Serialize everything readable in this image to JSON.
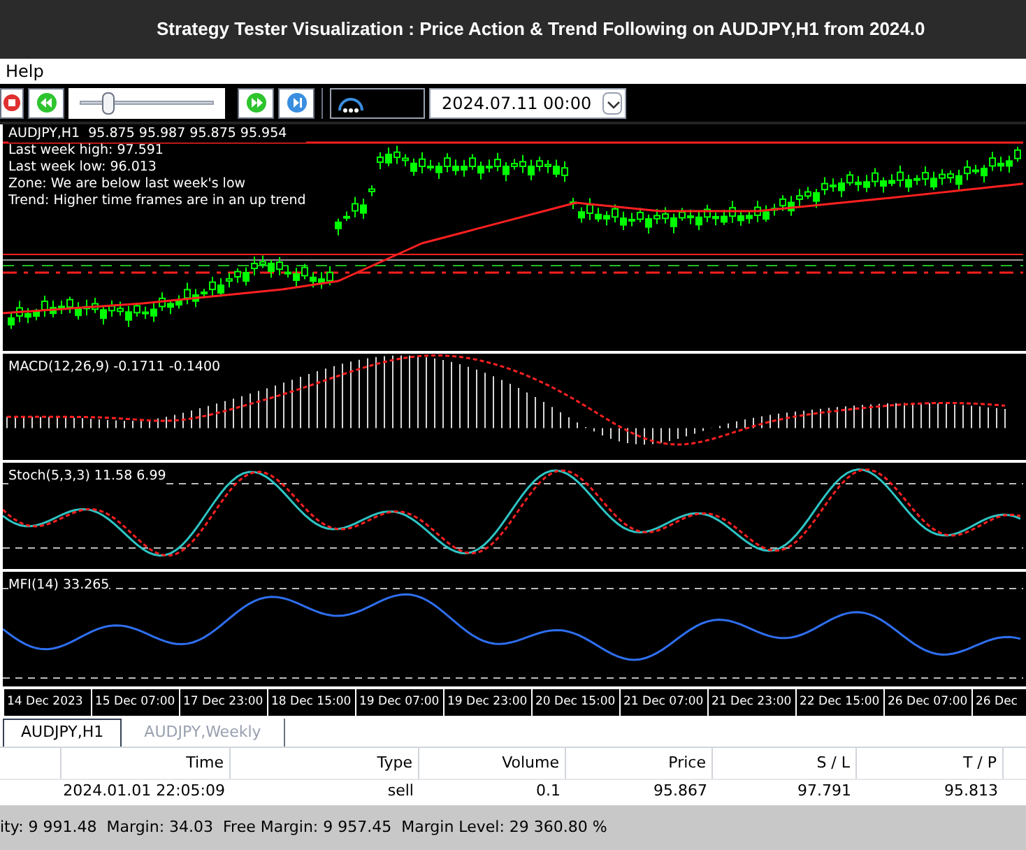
{
  "window": {
    "title": "Strategy Tester Visualization : Price Action & Trend Following on AUDJPY,H1 from 2024.0"
  },
  "menu": [
    "Help"
  ],
  "toolbar": {
    "speed": {
      "level": 0.2
    },
    "date": "2024.07.11 00:00"
  },
  "chart": {
    "symbol_line": "AUDJPY,H1  95.875 95.987 95.875 95.954",
    "info_lines": [
      "Last week high: 97.591",
      "Last week low: 96.013",
      "Zone: We are below last week's low",
      "Trend: Higher time frames are in an up trend"
    ]
  },
  "indicators": [
    {
      "kind": "macd",
      "label": "MACD(12,26,9) -0.1711 -0.1400"
    },
    {
      "kind": "stoch",
      "label": "Stoch(5,3,3) 11.58 6.99"
    },
    {
      "kind": "mfi",
      "label": "MFI(14) 33.265"
    }
  ],
  "time_axis": [
    "14 Dec 2023",
    "15 Dec 07:00",
    "17 Dec 23:00",
    "18 Dec 15:00",
    "19 Dec 07:00",
    "19 Dec 23:00",
    "20 Dec 15:00",
    "21 Dec 07:00",
    "21 Dec 23:00",
    "22 Dec 15:00",
    "26 Dec 07:00",
    "26 Dec"
  ],
  "tabs": [
    {
      "label": "AUDJPY,H1",
      "selected": true
    },
    {
      "label": "AUDJPY,Weekly",
      "selected": false
    }
  ],
  "table": {
    "columns": [
      "Time",
      "Type",
      "Volume",
      "Price",
      "S / L",
      "T / P"
    ],
    "rows": [
      [
        "2024.01.01 22:05:09",
        "sell",
        "0.1",
        "95.867",
        "97.791",
        "95.813"
      ]
    ]
  },
  "status_bar": "ity: 9 991.48  Margin: 34.03  Free Margin: 9 957.45  Margin Level: 29 360.80 %"
}
